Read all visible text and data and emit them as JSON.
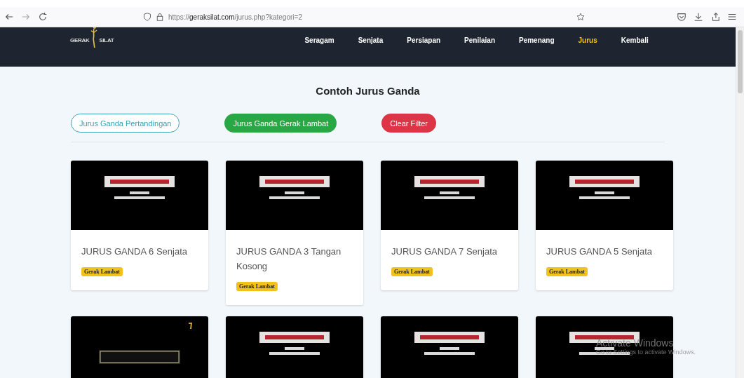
{
  "browser": {
    "url_scheme": "https://",
    "url_host": "geraksilat.com",
    "url_path": "/jurus.php?kategori=2"
  },
  "nav": {
    "logo": [
      "GERAK",
      "SILAT"
    ],
    "items": [
      {
        "label": "Seragam",
        "selected": false
      },
      {
        "label": "Senjata",
        "selected": false
      },
      {
        "label": "Persiapan",
        "selected": false
      },
      {
        "label": "Penilaian",
        "selected": false
      },
      {
        "label": "Pemenang",
        "selected": false
      },
      {
        "label": "Jurus",
        "selected": true
      },
      {
        "label": "Kembali",
        "selected": false
      }
    ]
  },
  "page_title": "Contoh Jurus Ganda",
  "filters": [
    {
      "label": "Jurus Ganda Pertandingan",
      "kind": "outline"
    },
    {
      "label": "Jurus Ganda Gerak Lambat",
      "kind": "success"
    },
    {
      "label": "Clear Filter",
      "kind": "danger"
    }
  ],
  "cards": [
    {
      "kind": "video",
      "title": "JURUS GANDA 6 Senjata",
      "tag": "Gerak Lambat"
    },
    {
      "kind": "video",
      "title": "JURUS GANDA 3 Tangan Kosong",
      "tag": "Gerak Lambat"
    },
    {
      "kind": "video",
      "title": "JURUS GANDA 7 Senjata",
      "tag": "Gerak Lambat"
    },
    {
      "kind": "video",
      "title": "JURUS GANDA 5 Senjata",
      "tag": "Gerak Lambat"
    },
    {
      "kind": "picture"
    },
    {
      "kind": "picture"
    },
    {
      "kind": "picture"
    },
    {
      "kind": "picture"
    }
  ],
  "os_notice": {
    "title": "Activate Windows",
    "text": "Go to Settings to activate Windows."
  }
}
